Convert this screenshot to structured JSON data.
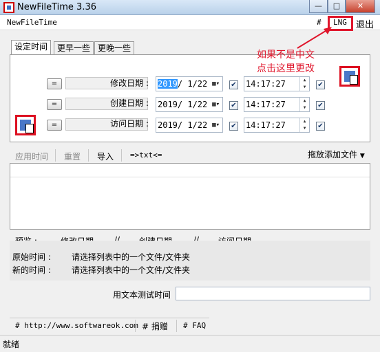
{
  "window": {
    "title": "NewFileTime 3.36",
    "minimize": "—",
    "maximize": "□",
    "close": "✕"
  },
  "menu": {
    "app_name": "NewFileTime",
    "hash": "#",
    "lng": "LNG",
    "exit": "退出"
  },
  "tabs": [
    "设定时间",
    "更早一些",
    "更晚一些"
  ],
  "annotation": {
    "line1": "如果不是中文",
    "line2": "点击这里更改",
    "color": "#e0152b"
  },
  "rows": [
    {
      "eq": "=",
      "label": "修改日期 :",
      "date_year": "2019",
      "date_rest": "/  1/22",
      "time": "14:17:27"
    },
    {
      "eq": "=",
      "label": "创建日期 :",
      "date_year": "2019",
      "date_rest": "/  1/22",
      "time": "14:17:27"
    },
    {
      "eq": "=",
      "label": "访问日期 :",
      "date_year": "2019",
      "date_rest": "/  1/22",
      "time": "14:17:27"
    }
  ],
  "toolbar": {
    "apply": "应用时间",
    "reset": "重置",
    "import": "导入",
    "txt": "=>txt<=",
    "drag_add": "拖放添加文件"
  },
  "preview": {
    "title": "预览  :",
    "mod": "修改日期",
    "sep1": "//",
    "create": "创建日期",
    "sep2": "//",
    "access": "访问日期",
    "orig_label": "原始时间  :",
    "orig_value": "请选择列表中的一个文件/文件夹",
    "new_label": "新的时间  :",
    "new_value": "请选择列表中的一个文件/文件夹"
  },
  "text_test": {
    "label": "用文本测试时间",
    "value": ""
  },
  "bottom": {
    "link1": "# http://www.softwareok.com",
    "link2": "# 捐赠",
    "link3": "# FAQ"
  },
  "status": "就绪"
}
